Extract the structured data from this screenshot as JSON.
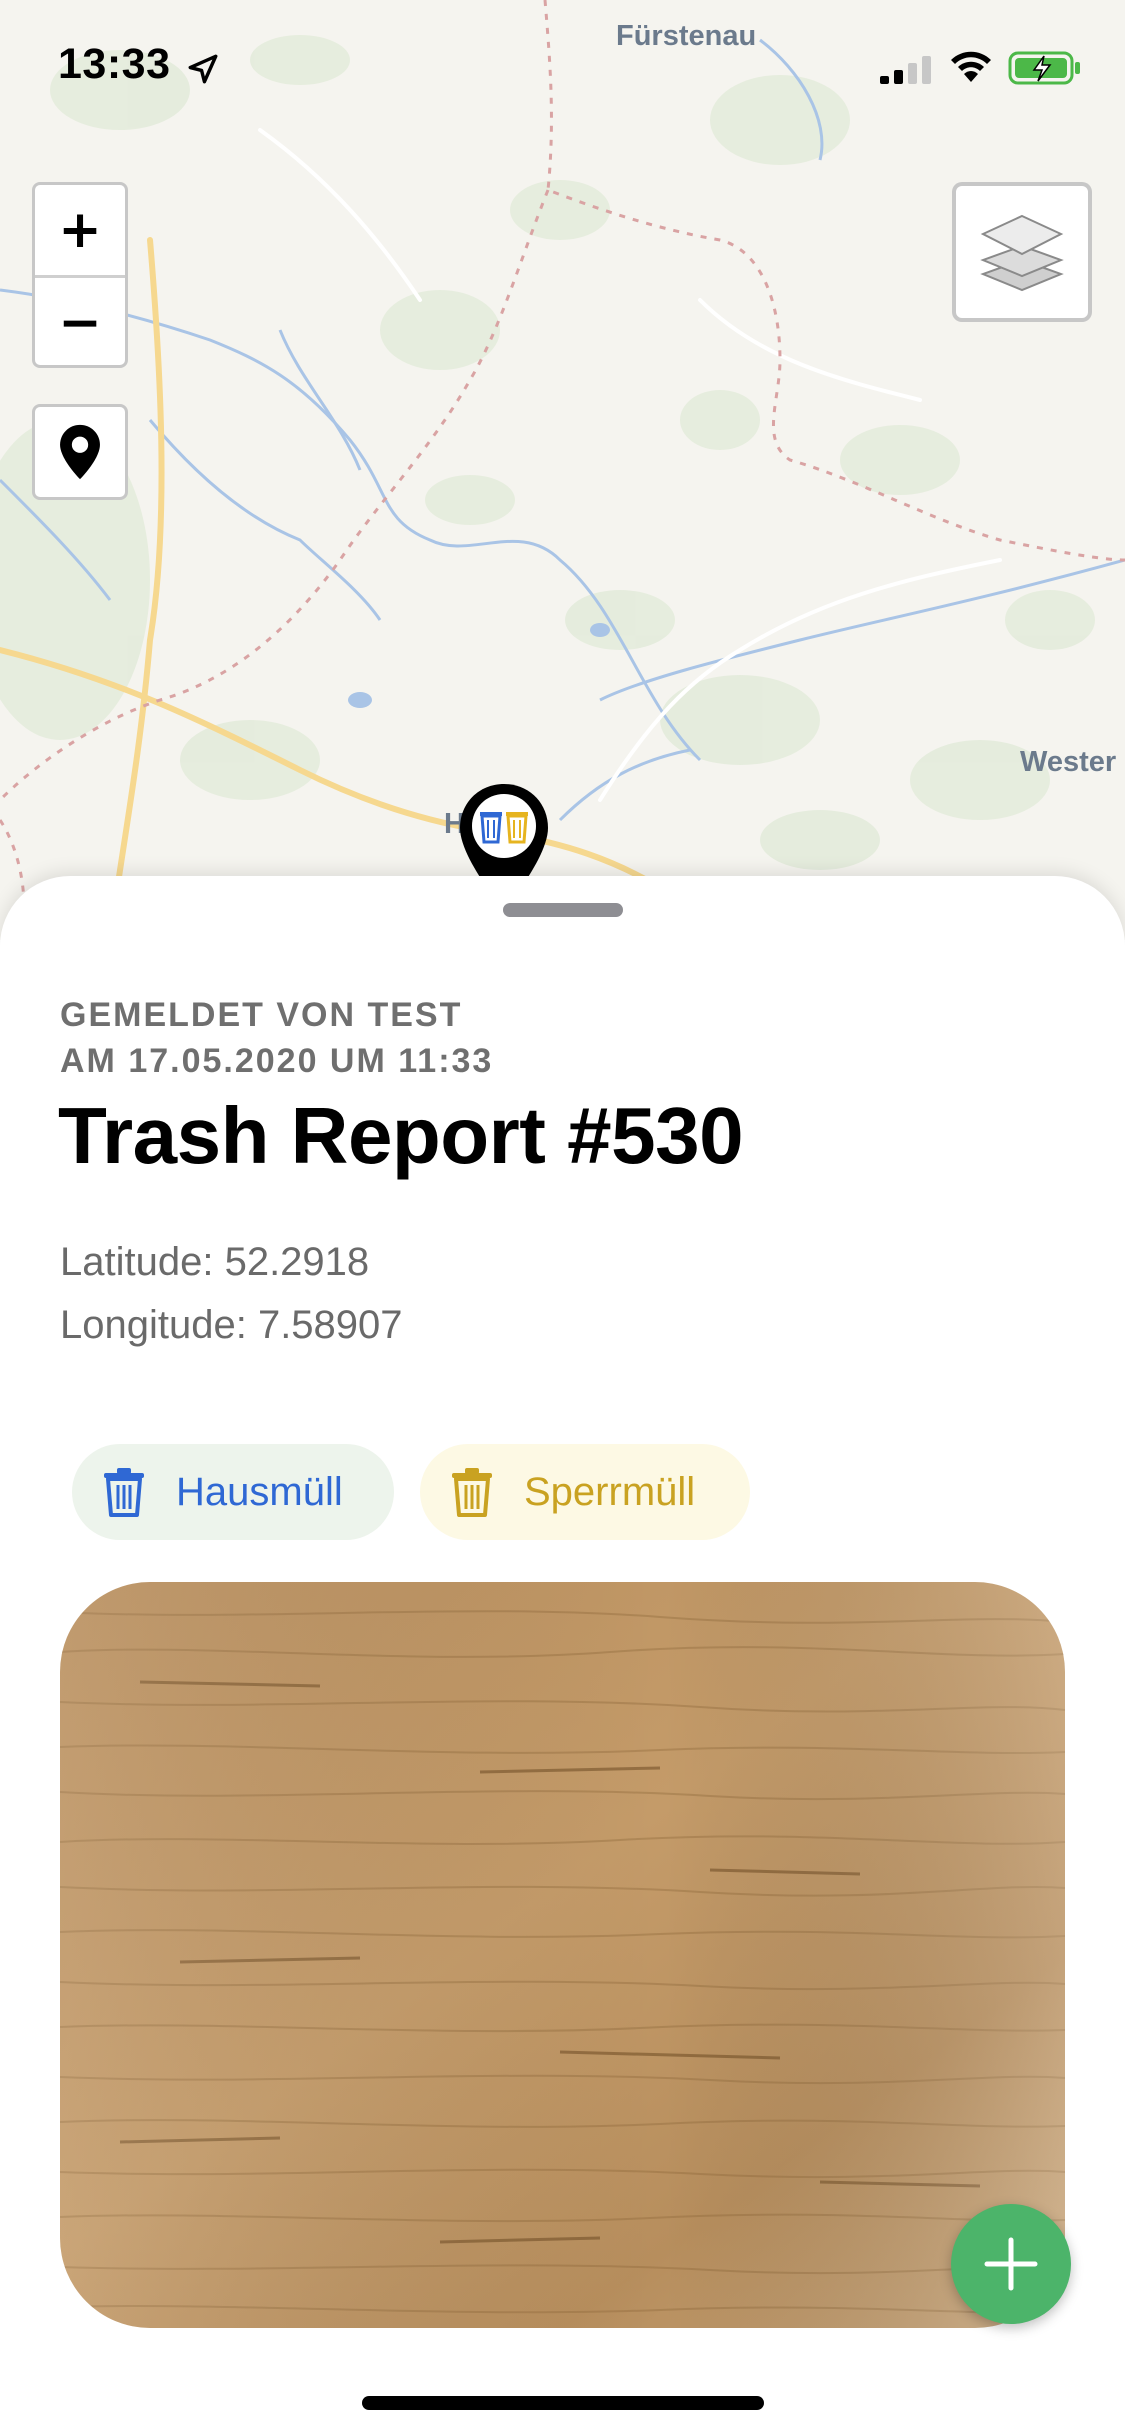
{
  "status_bar": {
    "time": "13:33"
  },
  "map": {
    "labels": {
      "top_town": "Fürstenau",
      "east_town": "Wester",
      "marker_town": "H"
    },
    "controls": {
      "zoom_in": "+",
      "zoom_out": "−"
    },
    "icons": {
      "locate": "location-pin-icon",
      "layers": "layers-icon",
      "marker": "trash-marker-icon"
    }
  },
  "report": {
    "reported_by_line1": "GEMELDET VON TEST",
    "reported_by_line2": "AM 17.05.2020 UM 11:33",
    "title": "Trash Report #530",
    "latitude": "Latitude: 52.2918",
    "longitude": "Longitude: 7.58907",
    "tags": [
      {
        "label": "Hausmüll",
        "icon": "trash-icon",
        "color": "#2f68d4",
        "background": "#edf4ec"
      },
      {
        "label": "Sperrmüll",
        "icon": "trash-icon",
        "color": "#c9a221",
        "background": "#fdf9e4"
      }
    ]
  },
  "fab": {
    "label": "+",
    "color": "#4cb46a",
    "icon": "plus-icon"
  },
  "colors": {
    "map_background": "#f5f4ef",
    "road_yellow": "#f6d88f",
    "water_blue": "#a9c4e6",
    "border_pink": "#d9a3a3"
  }
}
